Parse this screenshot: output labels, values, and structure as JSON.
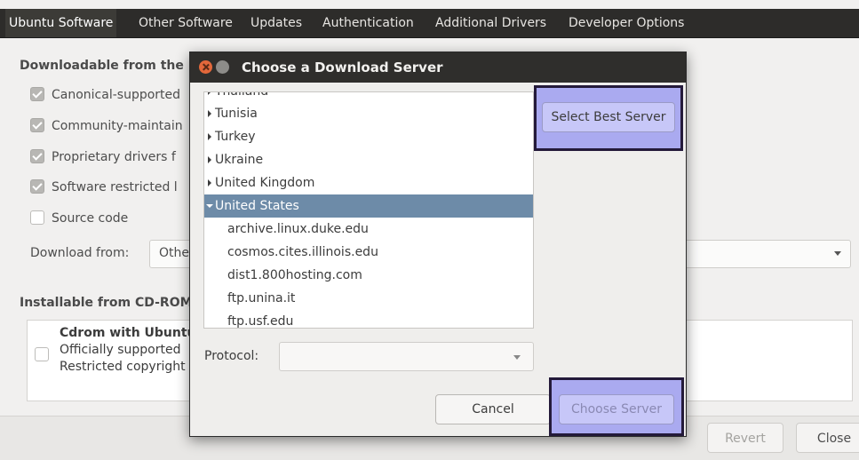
{
  "tabs": [
    "Ubuntu Software",
    "Other Software",
    "Updates",
    "Authentication",
    "Additional Drivers",
    "Developer Options"
  ],
  "background": {
    "downloadable_heading": "Downloadable from the",
    "checkboxes": [
      {
        "label": "Canonical-supported",
        "checked": true
      },
      {
        "label": "Community-maintain",
        "checked": true
      },
      {
        "label": "Proprietary drivers f",
        "checked": true
      },
      {
        "label": "Software restricted l",
        "checked": true
      },
      {
        "label": "Source code",
        "checked": false
      }
    ],
    "download_from_label": "Download from:",
    "download_from_value": "Othe",
    "installable_heading": "Installable from CD-ROM",
    "cdrom": {
      "title": "Cdrom with Ubuntu",
      "line1": "Officially supported",
      "line2": "Restricted copyright"
    },
    "revert_label": "Revert",
    "close_label": "Close"
  },
  "dialog": {
    "title": "Choose a Download Server",
    "countries": [
      "Thailand",
      "Tunisia",
      "Turkey",
      "Ukraine",
      "United Kingdom",
      "United States"
    ],
    "selected_country": "United States",
    "servers": [
      "archive.linux.duke.edu",
      "cosmos.cites.illinois.edu",
      "dist1.800hosting.com",
      "ftp.unina.it",
      "ftp.usf.edu"
    ],
    "select_best_label": "Select Best Server",
    "protocol_label": "Protocol:",
    "protocol_value": "",
    "cancel_label": "Cancel",
    "choose_label": "Choose Server"
  },
  "colors": {
    "highlight": "#aaaaf0",
    "selection": "#6d8ba8",
    "titlebar": "#2f2e2c"
  }
}
